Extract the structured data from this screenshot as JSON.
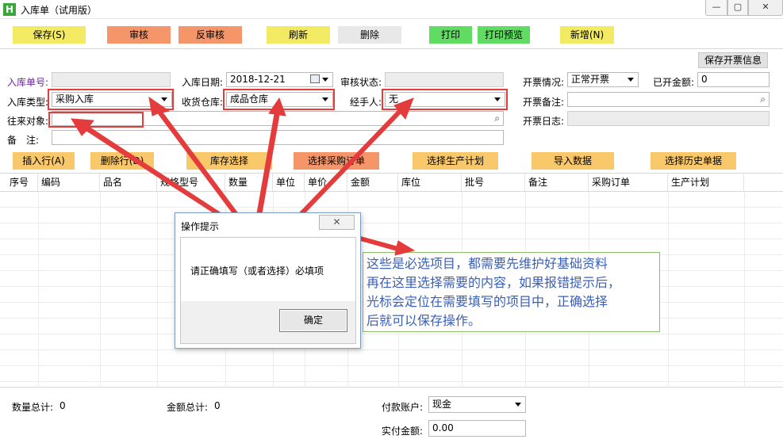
{
  "window": {
    "logo": "H",
    "title": "入库单（试用版）",
    "minimize_glyph": "—",
    "maximize_glyph": "▢",
    "close_glyph": "✕"
  },
  "toolbar": {
    "save": "保存(S)",
    "audit": "审核",
    "unaudit": "反审核",
    "refresh": "刷新",
    "delete": "删除",
    "print": "打印",
    "print_preview": "打印预览",
    "new": "新增(N)"
  },
  "form": {
    "entry_no_label": "入库单号:",
    "entry_no_value": "",
    "entry_date_label": "入库日期:",
    "entry_date_value": "2018-12-21",
    "audit_status_label": "审核状态:",
    "audit_status_value": "",
    "entry_type_label": "入库类型:",
    "entry_type_value": "采购入库",
    "warehouse_label": "收货仓库:",
    "warehouse_value": "成品仓库",
    "handler_label": "经手人:",
    "handler_value": "无",
    "partner_label": "往来对象:",
    "partner_value": "",
    "remark_label": "备　注:",
    "remark_value": "",
    "invoice_status_label": "开票情况:",
    "invoice_status_value": "正常开票",
    "invoiced_amount_label": "已开金额:",
    "invoiced_amount_value": "0",
    "invoice_remark_label": "开票备注:",
    "invoice_remark_value": "",
    "invoice_date_label": "开票日志:",
    "invoice_date_value": "",
    "save_invoice_button": "保存开票信息",
    "search_glyph": "⌕"
  },
  "actions": {
    "insert_row": "插入行(A)",
    "delete_row": "删除行(D)",
    "stock_select": "库存选择",
    "select_purchase_order": "选择采购订单",
    "select_production_plan": "选择生产计划",
    "import_data": "导入数据",
    "select_history": "选择历史单据"
  },
  "grid": {
    "columns": [
      "序号",
      "编码",
      "品名",
      "规格型号",
      "数量",
      "单位",
      "单价",
      "金额",
      "库位",
      "批号",
      "备注",
      "采购订单",
      "生产计划"
    ]
  },
  "footer": {
    "qty_total_label": "数量总计:",
    "qty_total_value": "0",
    "amount_total_label": "金额总计:",
    "amount_total_value": "0",
    "payment_account_label": "付款账户:",
    "payment_account_value": "现金",
    "actual_amount_label": "实付金额:",
    "actual_amount_value": "0.00"
  },
  "dialog": {
    "title": "操作提示",
    "close_glyph": "✕",
    "message": "请正确填写（或者选择）必填项",
    "ok_button": "确定"
  },
  "note": {
    "lines": [
      "这些是必选项目，都需要先维护好基础资料",
      "再在这里选择需要的内容，如果报错提示后，",
      "光标会定位在需要填写的项目中，正确选择",
      "后就可以保存操作。"
    ]
  },
  "colors": {
    "annotation_red": "#e43c3c",
    "note_text": "#3a5fb8",
    "note_border": "#8cc06a"
  }
}
